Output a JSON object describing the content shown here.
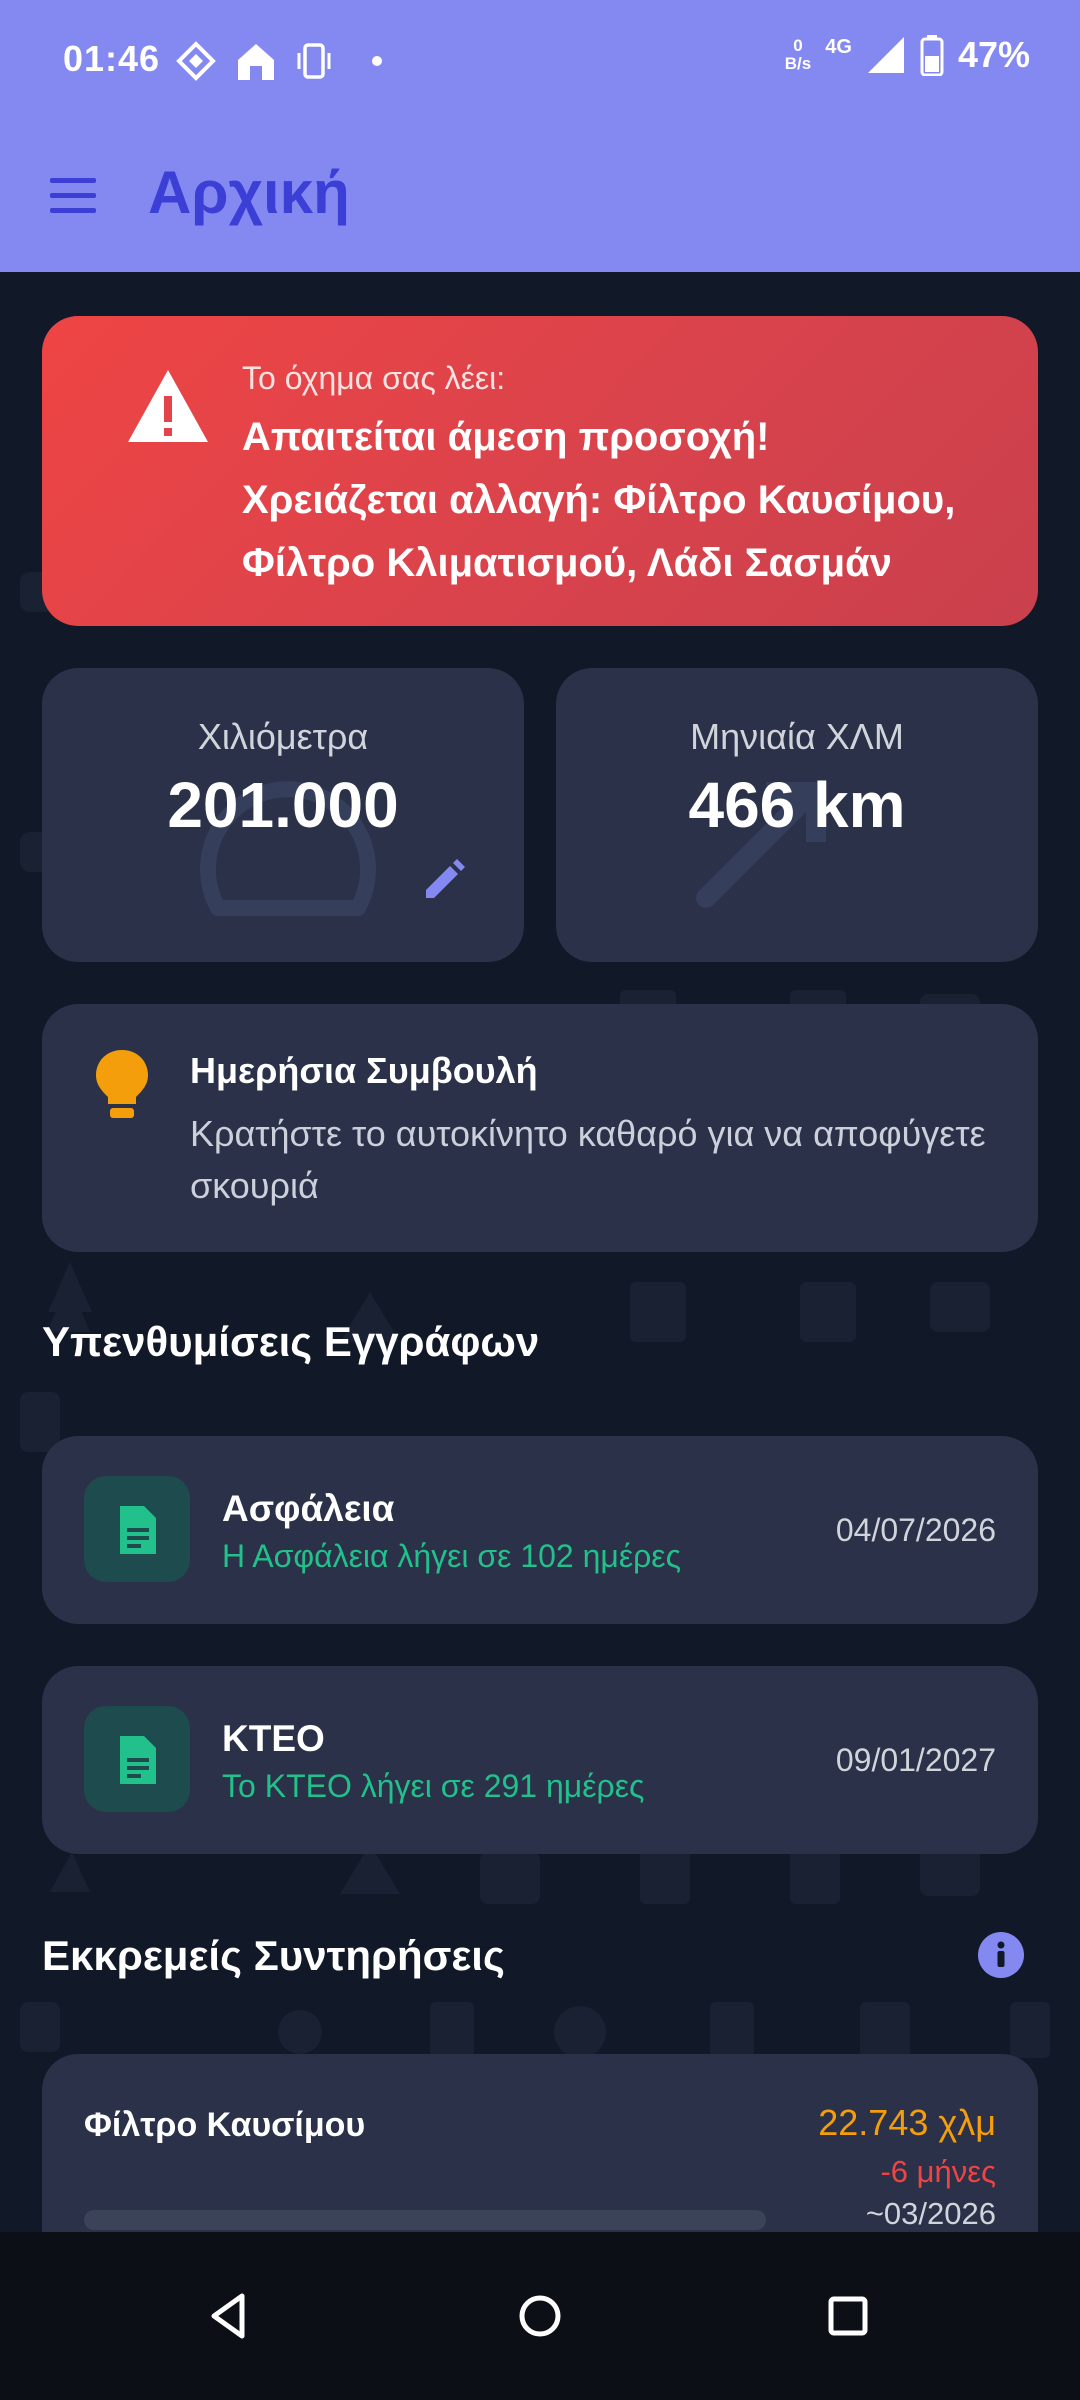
{
  "status": {
    "time": "01:46",
    "speed_value": "0",
    "speed_unit": "B/s",
    "network": "4G",
    "battery": "47%"
  },
  "header": {
    "title": "Αρχική"
  },
  "alert": {
    "kicker": "Το όχημα σας λέει:",
    "headline": "Απαιτείται άμεση προσοχή!",
    "detail": "Χρειάζεται αλλαγή: Φίλτρο Καυσίμου, Φίλτρο Κλιματισμού, Λάδι Σασμάν"
  },
  "stats": {
    "mileage": {
      "label": "Χιλιόμετρα",
      "value": "201.000"
    },
    "monthly": {
      "label": "Μηνιαία ΧΛΜ",
      "value": "466 km"
    }
  },
  "tip": {
    "title": "Ημερήσια Συμβουλή",
    "text": "Κρατήστε το αυτοκίνητο καθαρό για να αποφύγετε σκουριά"
  },
  "documents": {
    "title": "Υπενθυμίσεις Εγγράφων",
    "items": [
      {
        "title": "Ασφάλεια",
        "subtitle": "Η Ασφάλεια λήγει σε 102 ημέρες",
        "date": "04/07/2026"
      },
      {
        "title": "ΚΤΕΟ",
        "subtitle": "Το ΚΤΕΟ λήγει σε 291 ημέρες",
        "date": "09/01/2027"
      }
    ]
  },
  "maintenance": {
    "title": "Εκκρεμείς Συντηρήσεις",
    "items": [
      {
        "title": "Φίλτρο Καυσίμου",
        "km": "22.743 χλμ",
        "months": "-6 μήνες",
        "date": "~03/2026"
      }
    ]
  },
  "colors": {
    "accent": "#8489f2",
    "title": "#3b3fd6",
    "alert": "#ef4444",
    "ok": "#22c08a",
    "warn": "#f59e0b",
    "card": "#2a3148",
    "background": "#111827"
  }
}
